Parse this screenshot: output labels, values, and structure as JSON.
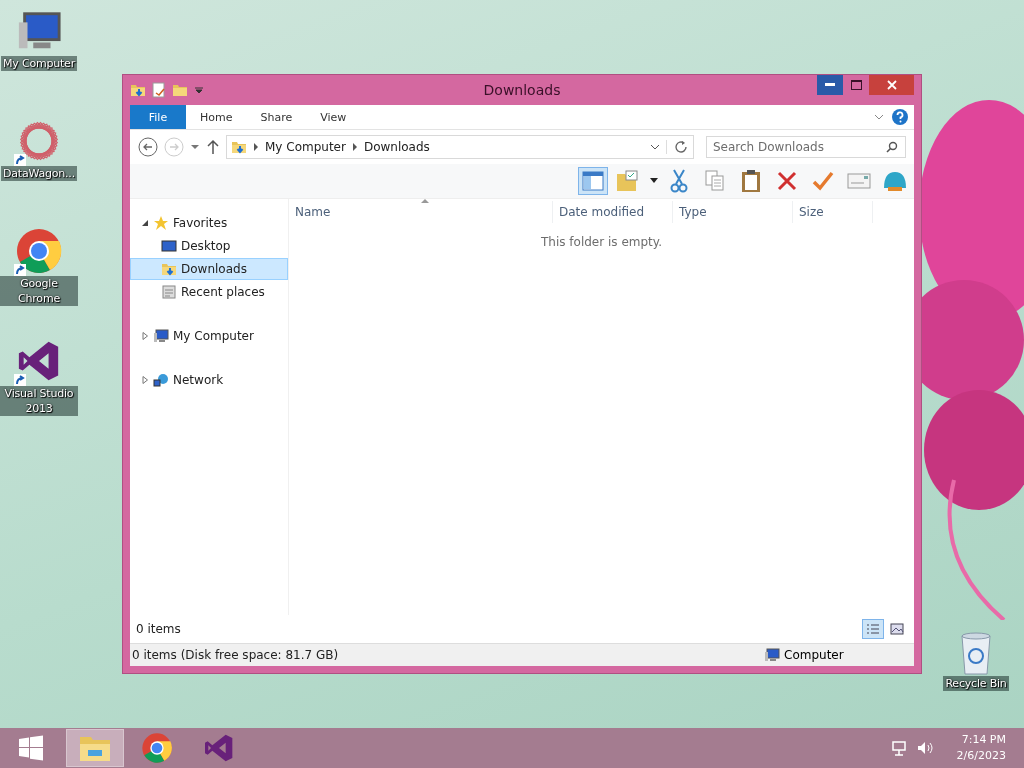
{
  "desktop_icons": [
    {
      "kind": "computer",
      "label": "My Computer",
      "shortcut": false
    },
    {
      "kind": "star",
      "label": "DataWagon...",
      "shortcut": true
    },
    {
      "kind": "chrome",
      "label": "Google Chrome",
      "shortcut": true
    },
    {
      "kind": "vs",
      "label": "Visual Studio 2013",
      "shortcut": true
    }
  ],
  "window": {
    "title": "Downloads",
    "ribbon_tabs": [
      {
        "kind": "file",
        "label": "File"
      },
      {
        "kind": "tab",
        "label": "Home"
      },
      {
        "kind": "tab",
        "label": "Share"
      },
      {
        "kind": "tab",
        "label": "View"
      }
    ],
    "address": {
      "path": [
        "My Computer",
        "Downloads"
      ]
    },
    "search": {
      "placeholder": "Search Downloads"
    },
    "nav_tree": [
      {
        "kind": "favorites",
        "label": "Favorites",
        "expanded": true,
        "selected": false,
        "children": [
          {
            "kind": "desktop",
            "label": "Desktop",
            "selected": false
          },
          {
            "kind": "downloads",
            "label": "Downloads",
            "selected": true
          },
          {
            "kind": "recent",
            "label": "Recent places",
            "selected": false
          }
        ]
      },
      {
        "kind": "computer",
        "label": "My Computer",
        "expanded": false,
        "selected": false
      },
      {
        "kind": "network",
        "label": "Network",
        "expanded": false,
        "selected": false
      }
    ],
    "columns": [
      {
        "label": "Name",
        "sorted": true
      },
      {
        "label": "Date modified",
        "sorted": false
      },
      {
        "label": "Type",
        "sorted": false
      },
      {
        "label": "Size",
        "sorted": false
      }
    ],
    "empty_message": "This folder is empty.",
    "item_count": "0 items",
    "view_buttons": [
      {
        "kind": "details",
        "selected": true
      },
      {
        "kind": "thumbnails",
        "selected": false
      }
    ],
    "status_bar": {
      "text": "0 items (Disk free space: 81.7 GB)",
      "location": "Computer"
    }
  },
  "recycle_bin": {
    "label": "Recycle Bin"
  },
  "taskbar": {
    "apps": [
      {
        "kind": "explorer",
        "active": true
      },
      {
        "kind": "chrome",
        "active": false
      },
      {
        "kind": "vs",
        "active": false
      }
    ],
    "time": "7:14 PM",
    "date": "2/6/2023"
  }
}
